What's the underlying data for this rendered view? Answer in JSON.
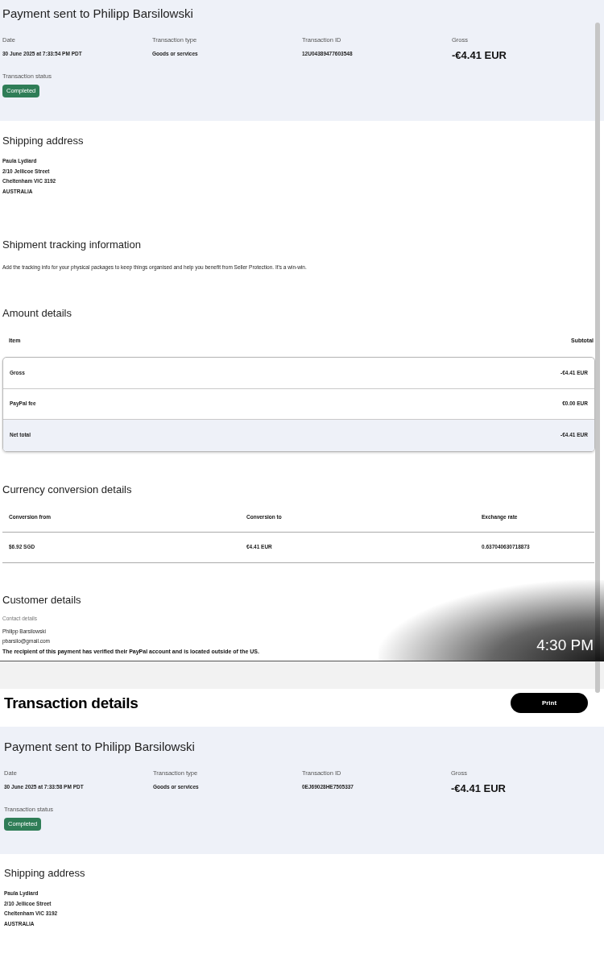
{
  "upper_view": {
    "summary": {
      "title": "Payment sent to Philipp Barsilowski",
      "fields": [
        {
          "kind": "text",
          "label": "Date",
          "value": "30 June 2025 at 7:33:54 PM PDT"
        },
        {
          "kind": "text",
          "label": "Transaction type",
          "value": "Goods or services"
        },
        {
          "kind": "text",
          "label": "Transaction ID",
          "value": "12U04389477603548"
        },
        {
          "kind": "amount",
          "label": "Gross",
          "value": "-€4.41 EUR"
        }
      ],
      "status": {
        "label": "Transaction status",
        "badge": "Completed"
      }
    },
    "shipping_address": {
      "heading": "Shipping address",
      "lines": [
        "Paula Lydiard",
        "2/10 Jellicoe Street",
        "Cheltenham VIC 3192",
        "AUSTRALIA"
      ]
    },
    "shipment_tracking": {
      "heading": "Shipment tracking information",
      "text": "Add the tracking info for your physical packages to keep things organised and help you benefit from Seller Protection. It's a win-win."
    },
    "amount_details": {
      "heading": "Amount details",
      "columns": [
        "Item",
        "Subtotal"
      ],
      "rows": [
        {
          "kind": "line",
          "item": "Gross",
          "subtotal": "-€4.41 EUR"
        },
        {
          "kind": "line",
          "item": "PayPal fee",
          "subtotal": "€0.00 EUR"
        },
        {
          "kind": "total",
          "item": "Net total",
          "subtotal": "-€4.41 EUR"
        }
      ]
    },
    "currency_conversion": {
      "heading": "Currency conversion details",
      "columns": [
        "Conversion from",
        "Conversion to",
        "Exchange rate"
      ],
      "rows": [
        [
          "$6.92 SGD",
          "€4.41 EUR",
          "0.637040630718873"
        ]
      ]
    },
    "customer_details": {
      "heading": "Customer details",
      "subheading": "Contact details",
      "lines": [
        "Philipp Barsilowski",
        "pbarsilo@gmail.com"
      ],
      "note": "The recipient of this payment has verified their PayPal account and is located outside of the US."
    }
  },
  "timestamp_overlay": "4:30 PM",
  "lower_view": {
    "header": {
      "title": "Transaction details",
      "print_button": "Print"
    },
    "summary": {
      "title": "Payment sent to Philipp Barsilowski",
      "fields": [
        {
          "kind": "text",
          "label": "Date",
          "value": "30 June 2025 at 7:33:58 PM PDT"
        },
        {
          "kind": "text",
          "label": "Transaction type",
          "value": "Goods or services"
        },
        {
          "kind": "text",
          "label": "Transaction ID",
          "value": "0EJ69028HE7505337"
        },
        {
          "kind": "amount",
          "label": "Gross",
          "value": "-€4.41 EUR"
        }
      ],
      "status": {
        "label": "Transaction status",
        "badge": "Completed"
      }
    },
    "shipping_address": {
      "heading": "Shipping address",
      "lines": [
        "Paula Lydiard",
        "2/10 Jellicoe Street",
        "Cheltenham VIC 3192",
        "AUSTRALIA"
      ]
    }
  }
}
